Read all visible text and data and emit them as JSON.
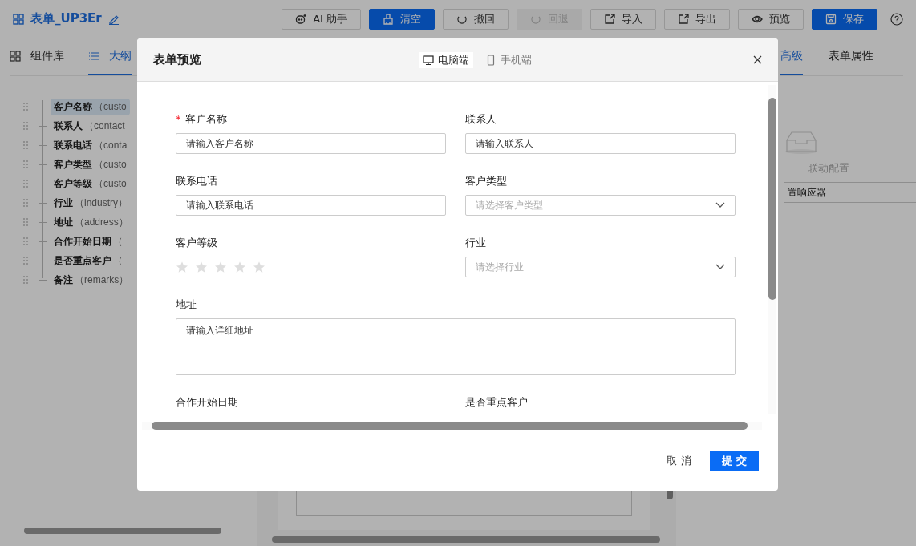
{
  "app": {
    "title": "表单_UP3Er",
    "toolbar": [
      {
        "label": "AI 助手",
        "kind": "ai",
        "primary": false,
        "disabled": false
      },
      {
        "label": "清空",
        "kind": "clear",
        "primary": true,
        "disabled": false
      },
      {
        "label": "撤回",
        "kind": "undo",
        "primary": false,
        "disabled": false
      },
      {
        "label": "回退",
        "kind": "redo",
        "primary": false,
        "disabled": true
      },
      {
        "label": "导入",
        "kind": "import",
        "primary": false,
        "disabled": false
      },
      {
        "label": "导出",
        "kind": "export",
        "primary": false,
        "disabled": false
      },
      {
        "label": "预览",
        "kind": "preview",
        "primary": false,
        "disabled": false
      },
      {
        "label": "保存",
        "kind": "save",
        "primary": true,
        "disabled": false
      }
    ]
  },
  "left_panel": {
    "tabs": [
      {
        "label": "组件库",
        "kind": "grid",
        "selected": false
      },
      {
        "label": "大纲",
        "kind": "list",
        "selected": true
      }
    ],
    "outline": [
      {
        "label": "客户名称",
        "key": "（custo",
        "selected": true
      },
      {
        "label": "联系人",
        "key": "（contact",
        "selected": false
      },
      {
        "label": "联系电话",
        "key": "（conta",
        "selected": false
      },
      {
        "label": "客户类型",
        "key": "（custo",
        "selected": false
      },
      {
        "label": "客户等级",
        "key": "（custo",
        "selected": false
      },
      {
        "label": "行业",
        "key": "（industry）",
        "selected": false
      },
      {
        "label": "地址",
        "key": "（address）",
        "selected": false
      },
      {
        "label": "合作开始日期",
        "key": "（",
        "selected": false
      },
      {
        "label": "是否重点客户",
        "key": "（",
        "selected": false
      },
      {
        "label": "备注",
        "key": "（remarks）",
        "selected": false
      }
    ]
  },
  "right_panel": {
    "tabs": [
      {
        "label": "高级",
        "selected": true
      },
      {
        "label": "表单属性",
        "selected": false
      }
    ],
    "empty_text": "联动配置",
    "button": "置响应器"
  },
  "dialog": {
    "title": "表单预览",
    "devices": [
      {
        "label": "电脑端",
        "kind": "desktop",
        "selected": true
      },
      {
        "label": "手机端",
        "kind": "mobile",
        "selected": false
      }
    ],
    "fields": [
      {
        "label": "客户名称",
        "required": true,
        "required_mark": "*",
        "kind": "input",
        "placeholder": "请输入客户名称"
      },
      {
        "label": "联系人",
        "required": false,
        "kind": "input",
        "placeholder": "请输入联系人"
      },
      {
        "label": "联系电话",
        "required": false,
        "kind": "input",
        "placeholder": "请输入联系电话"
      },
      {
        "label": "客户类型",
        "required": false,
        "kind": "select",
        "placeholder": "请选择客户类型"
      },
      {
        "label": "客户等级",
        "required": false,
        "kind": "rate",
        "stars": 0
      },
      {
        "label": "行业",
        "required": false,
        "kind": "select",
        "placeholder": "请选择行业"
      },
      {
        "label": "地址",
        "required": false,
        "kind": "textarea",
        "placeholder": "请输入详细地址"
      },
      {
        "label": "合作开始日期",
        "required": false,
        "kind": "label"
      },
      {
        "label": "是否重点客户",
        "required": false,
        "kind": "label"
      }
    ],
    "buttons": [
      {
        "label": "取 消",
        "primary": false
      },
      {
        "label": "提 交",
        "primary": true
      }
    ]
  }
}
